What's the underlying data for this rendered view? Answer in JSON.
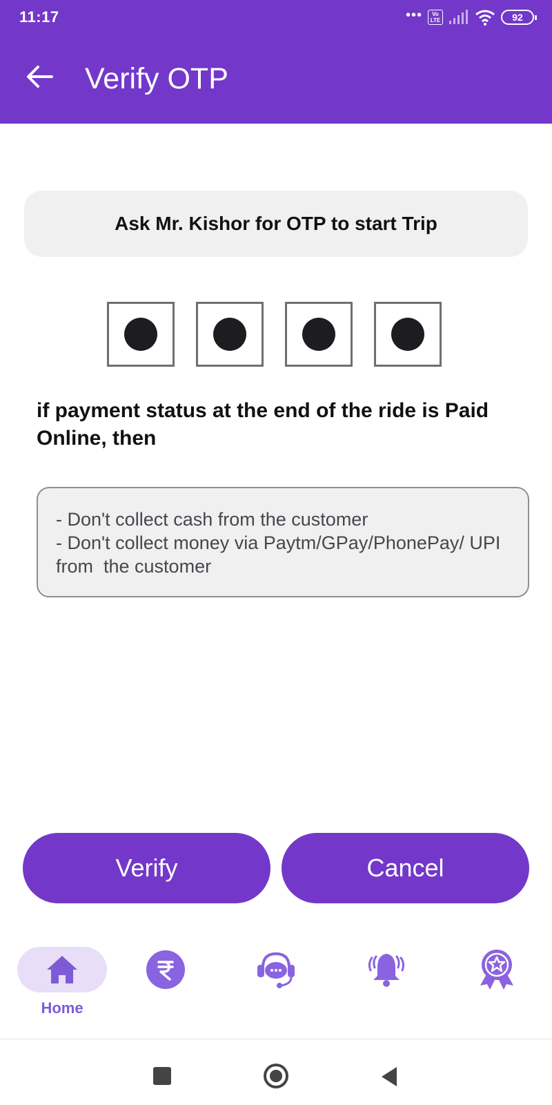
{
  "status_bar": {
    "time": "11:17",
    "dots": "•••",
    "network_badge": "Vo LTE",
    "battery": "92",
    "icons": [
      "signal-icon",
      "wifi-icon",
      "battery-icon"
    ]
  },
  "app_bar": {
    "title": "Verify OTP",
    "back_icon": "arrow-left-icon"
  },
  "otp": {
    "banner_text": "Ask Mr. Kishor for OTP to start Trip",
    "digit_count": 4,
    "masked": true
  },
  "payment_note": "if payment status at the end of the ride is Paid Online, then",
  "instructions": {
    "line1": "- Don't collect cash from the customer",
    "line2": "- Don't collect money via Paytm/GPay/PhonePay/ UPI from  the customer"
  },
  "actions": {
    "verify_label": "Verify",
    "cancel_label": "Cancel"
  },
  "bottom_nav": {
    "items": [
      {
        "icon": "home-icon",
        "label": "Home",
        "active": true
      },
      {
        "icon": "rupee-icon",
        "label": "",
        "active": false
      },
      {
        "icon": "support-chat-icon",
        "label": "",
        "active": false
      },
      {
        "icon": "bell-ringing-icon",
        "label": "",
        "active": false
      },
      {
        "icon": "award-badge-icon",
        "label": "",
        "active": false
      }
    ]
  },
  "colors": {
    "primary": "#7338c9",
    "nav_icon": "#8a63e0",
    "nav_active_bg": "#e8def8",
    "banner_bg": "#f0f0f1"
  }
}
